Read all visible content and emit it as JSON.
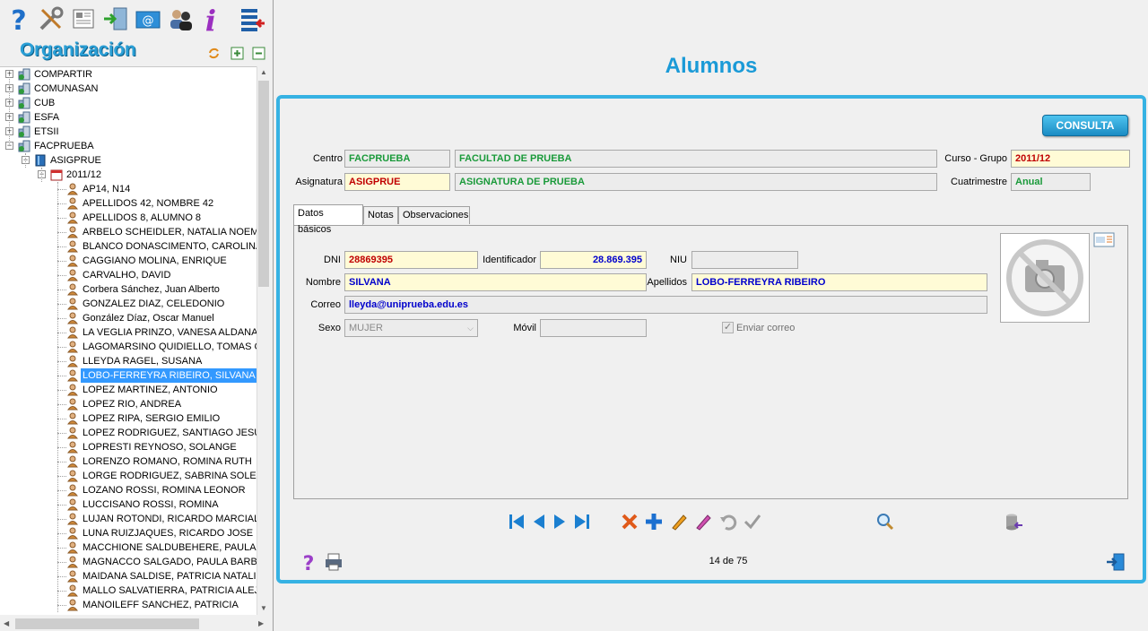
{
  "left": {
    "org_title": "Organización",
    "tree": [
      {
        "label": "COMPARTIR",
        "level": 0,
        "expander": "+",
        "icon": "building-icon"
      },
      {
        "label": "COMUNASAN",
        "level": 0,
        "expander": "+",
        "icon": "building-icon"
      },
      {
        "label": "CUB",
        "level": 0,
        "expander": "+",
        "icon": "building-icon"
      },
      {
        "label": "ESFA",
        "level": 0,
        "expander": "+",
        "icon": "building-icon"
      },
      {
        "label": "ETSII",
        "level": 0,
        "expander": "+",
        "icon": "building-icon"
      },
      {
        "label": "FACPRUEBA",
        "level": 0,
        "expander": "-",
        "icon": "building-icon"
      },
      {
        "label": "ASIGPRUE",
        "level": 1,
        "expander": "-",
        "icon": "book-icon"
      },
      {
        "label": "2011/12",
        "level": 2,
        "expander": "-",
        "icon": "calendar-icon"
      },
      {
        "label": "AP14, N14",
        "level": 3,
        "icon": "student-icon"
      },
      {
        "label": "APELLIDOS 42, NOMBRE 42",
        "level": 3,
        "icon": "student-icon"
      },
      {
        "label": "APELLIDOS 8, ALUMNO 8",
        "level": 3,
        "icon": "student-icon"
      },
      {
        "label": "ARBELO SCHEIDLER, NATALIA NOEMI",
        "level": 3,
        "icon": "student-icon"
      },
      {
        "label": "BLANCO DONASCIMENTO, CAROLINA L",
        "level": 3,
        "icon": "student-icon"
      },
      {
        "label": "CAGGIANO MOLINA, ENRIQUE",
        "level": 3,
        "icon": "student-icon"
      },
      {
        "label": "CARVALHO, DAVID",
        "level": 3,
        "icon": "student-icon"
      },
      {
        "label": "Corbera Sánchez, Juan Alberto",
        "level": 3,
        "icon": "student-icon"
      },
      {
        "label": "GONZALEZ DIAZ, CELEDONIO",
        "level": 3,
        "icon": "student-icon"
      },
      {
        "label": "González Díaz, Oscar Manuel",
        "level": 3,
        "icon": "student-icon"
      },
      {
        "label": "LA VEGLIA PRINZO, VANESA ALDANA",
        "level": 3,
        "icon": "student-icon"
      },
      {
        "label": "LAGOMARSINO QUIDIELLO, TOMAS GE",
        "level": 3,
        "icon": "student-icon"
      },
      {
        "label": "LLEYDA RAGEL, SUSANA",
        "level": 3,
        "icon": "student-icon"
      },
      {
        "label": "LOBO-FERREYRA RIBEIRO, SILVANA",
        "level": 3,
        "icon": "student-icon",
        "selected": true
      },
      {
        "label": "LOPEZ MARTINEZ, ANTONIO",
        "level": 3,
        "icon": "student-icon"
      },
      {
        "label": "LOPEZ RIO, ANDREA",
        "level": 3,
        "icon": "student-icon"
      },
      {
        "label": "LOPEZ RIPA, SERGIO EMILIO",
        "level": 3,
        "icon": "student-icon"
      },
      {
        "label": "LOPEZ RODRIGUEZ, SANTIAGO JESUS",
        "level": 3,
        "icon": "student-icon"
      },
      {
        "label": "LOPRESTI REYNOSO, SOLANGE",
        "level": 3,
        "icon": "student-icon"
      },
      {
        "label": "LORENZO ROMANO, ROMINA RUTH",
        "level": 3,
        "icon": "student-icon"
      },
      {
        "label": "LORGE RODRIGUEZ, SABRINA SOLEDA",
        "level": 3,
        "icon": "student-icon"
      },
      {
        "label": "LOZANO ROSSI, ROMINA LEONOR",
        "level": 3,
        "icon": "student-icon"
      },
      {
        "label": "LUCCISANO ROSSI, ROMINA",
        "level": 3,
        "icon": "student-icon"
      },
      {
        "label": "LUJAN ROTONDI, RICARDO MARCIAL",
        "level": 3,
        "icon": "student-icon"
      },
      {
        "label": "LUNA RUIZJAQUES, RICARDO JOSE",
        "level": 3,
        "icon": "student-icon"
      },
      {
        "label": "MACCHIONE SALDUBEHERE, PAULA MA",
        "level": 3,
        "icon": "student-icon"
      },
      {
        "label": "MAGNACCO SALGADO, PAULA BARBAR",
        "level": 3,
        "icon": "student-icon"
      },
      {
        "label": "MAIDANA SALDISE, PATRICIA NATALI",
        "level": 3,
        "icon": "student-icon"
      },
      {
        "label": "MALLO SALVATIERRA, PATRICIA ALEJA",
        "level": 3,
        "icon": "student-icon"
      },
      {
        "label": "MANOILEFF SANCHEZ, PATRICIA",
        "level": 3,
        "icon": "student-icon"
      }
    ]
  },
  "main": {
    "title": "Alumnos",
    "consulta_button": "CONSULTA",
    "centro_label": "Centro",
    "centro_code": "FACPRUEBA",
    "centro_name": "FACULTAD DE PRUEBA",
    "curso_label": "Curso - Grupo",
    "curso_value": "2011/12",
    "asignatura_label": "Asignatura",
    "asignatura_code": "ASIGPRUE",
    "asignatura_name": "ASIGNATURA DE PRUEBA",
    "cuatrimestre_label": "Cuatrimestre",
    "cuatrimestre_value": "Anual",
    "tabs": [
      "Datos básicos",
      "Notas",
      "Observaciones"
    ],
    "dni_label": "DNI",
    "dni_value": "28869395",
    "identificador_label": "Identificador",
    "identificador_value": "28.869.395",
    "niu_label": "NIU",
    "niu_value": "",
    "nombre_label": "Nombre",
    "nombre_value": "SILVANA",
    "apellidos_label": "Apellidos",
    "apellidos_value": "LOBO-FERREYRA RIBEIRO",
    "correo_label": "Correo",
    "correo_value": "lleyda@uniprueba.edu.es",
    "sexo_label": "Sexo",
    "sexo_value": "MUJER",
    "movil_label": "Móvil",
    "movil_value": "",
    "enviar_label": "Enviar correo",
    "record_counter": "14 de 75"
  },
  "colors": {
    "accent": "#36b2e3",
    "title": "#1a9ad7",
    "field_yellow": "#fffbd6",
    "green_text": "#1a9a3a",
    "red_text": "#c00000",
    "blue_text": "#0000cc",
    "selection": "#3399ff"
  }
}
